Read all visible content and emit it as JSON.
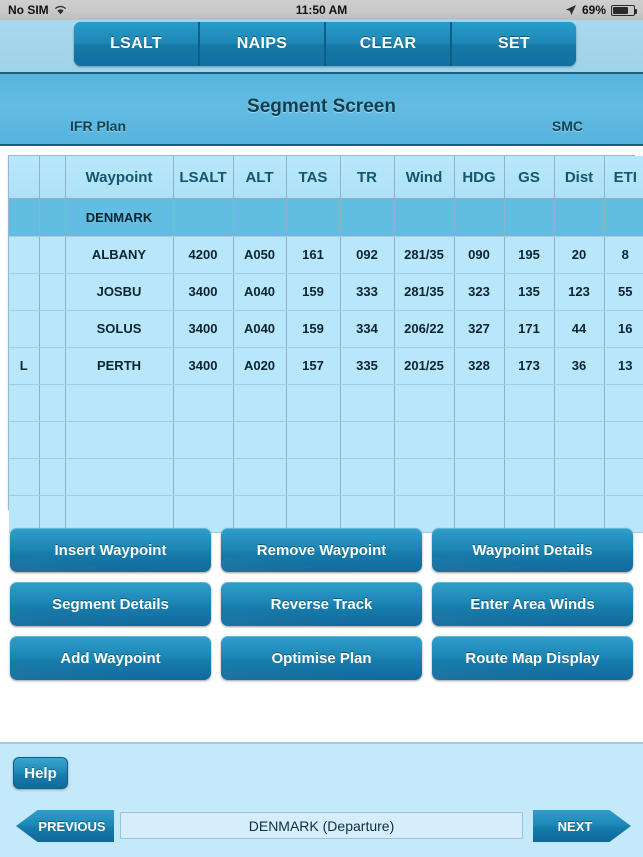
{
  "status_bar": {
    "carrier": "No SIM",
    "wifi_icon": "wifi-icon",
    "time": "11:50 AM",
    "location_icon": "location-arrow-icon",
    "battery_percent": "69%",
    "battery_icon": "battery-icon"
  },
  "toolbar": {
    "segments": [
      {
        "label": "LSALT"
      },
      {
        "label": "NAIPS"
      },
      {
        "label": "CLEAR"
      },
      {
        "label": "SET"
      }
    ]
  },
  "header": {
    "title": "Segment Screen",
    "left_label": "IFR Plan",
    "right_label": "SMC"
  },
  "table": {
    "columns": [
      "",
      "",
      "Waypoint",
      "LSALT",
      "ALT",
      "TAS",
      "TR",
      "Wind",
      "HDG",
      "GS",
      "Dist",
      "ETI"
    ],
    "rows": [
      {
        "selected": true,
        "flag": "",
        "cells": [
          "DENMARK",
          "",
          "",
          "",
          "",
          "",
          "",
          "",
          "",
          ""
        ]
      },
      {
        "selected": false,
        "flag": "",
        "cells": [
          "ALBANY",
          "4200",
          "A050",
          "161",
          "092",
          "281/35",
          "090",
          "195",
          "20",
          "8"
        ]
      },
      {
        "selected": false,
        "flag": "",
        "cells": [
          "JOSBU",
          "3400",
          "A040",
          "159",
          "333",
          "281/35",
          "323",
          "135",
          "123",
          "55"
        ]
      },
      {
        "selected": false,
        "flag": "",
        "cells": [
          "SOLUS",
          "3400",
          "A040",
          "159",
          "334",
          "206/22",
          "327",
          "171",
          "44",
          "16"
        ]
      },
      {
        "selected": false,
        "flag": "L",
        "cells": [
          "PERTH",
          "3400",
          "A020",
          "157",
          "335",
          "201/25",
          "328",
          "173",
          "36",
          "13"
        ]
      },
      {
        "selected": false,
        "flag": "",
        "cells": [
          "",
          "",
          "",
          "",
          "",
          "",
          "",
          "",
          "",
          ""
        ]
      },
      {
        "selected": false,
        "flag": "",
        "cells": [
          "",
          "",
          "",
          "",
          "",
          "",
          "",
          "",
          "",
          ""
        ]
      },
      {
        "selected": false,
        "flag": "",
        "cells": [
          "",
          "",
          "",
          "",
          "",
          "",
          "",
          "",
          "",
          ""
        ]
      },
      {
        "selected": false,
        "flag": "",
        "cells": [
          "",
          "",
          "",
          "",
          "",
          "",
          "",
          "",
          "",
          ""
        ]
      }
    ]
  },
  "actions": [
    {
      "label": "Insert Waypoint",
      "name": "insert-waypoint-button"
    },
    {
      "label": "Remove Waypoint",
      "name": "remove-waypoint-button"
    },
    {
      "label": "Waypoint Details",
      "name": "waypoint-details-button"
    },
    {
      "label": "Segment Details",
      "name": "segment-details-button"
    },
    {
      "label": "Reverse Track",
      "name": "reverse-track-button"
    },
    {
      "label": "Enter Area Winds",
      "name": "enter-area-winds-button"
    },
    {
      "label": "Add Waypoint",
      "name": "add-waypoint-button"
    },
    {
      "label": "Optimise Plan",
      "name": "optimise-plan-button"
    },
    {
      "label": "Route Map Display",
      "name": "route-map-display-button"
    }
  ],
  "footer": {
    "help_label": "Help",
    "previous_label": "PREVIOUS",
    "next_label": "NEXT",
    "current_value": "DENMARK (Departure)"
  },
  "colors": {
    "accent": "#1d87b6",
    "header_blue": "#62bce2",
    "table_bg": "#b8e6fa",
    "selected_row": "#62bde3",
    "bottom_bar": "#c3e9fa"
  }
}
